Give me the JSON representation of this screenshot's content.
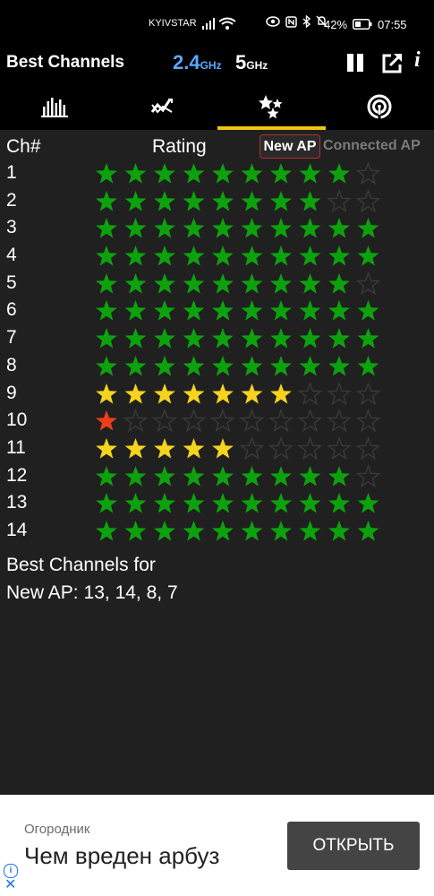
{
  "status_bar": {
    "carrier": "KYIVSTAR",
    "battery_percent": "42%",
    "time": "07:55"
  },
  "header": {
    "title": "Best Channels",
    "band_24": "2.4",
    "band_24_unit": "GHz",
    "band_5": "5",
    "band_5_unit": "GHz",
    "info_label": "i"
  },
  "tabs": {
    "icons": [
      "channel-graph-icon",
      "time-graph-icon",
      "channel-rating-icon",
      "ap-list-icon"
    ],
    "active_index": 2
  },
  "rating": {
    "ch_header": "Ch#",
    "rating_header": "Rating",
    "mode_new": "New AP",
    "mode_connected": "Connected AP",
    "max_stars": 10,
    "colors": {
      "green": "#0da20d",
      "yellow": "#f5d31e",
      "red": "#ee3d1a",
      "empty": "#3a3a3a"
    },
    "rows": [
      {
        "ch": "1",
        "stars": 9,
        "color": "green"
      },
      {
        "ch": "2",
        "stars": 8,
        "color": "green"
      },
      {
        "ch": "3",
        "stars": 10,
        "color": "green"
      },
      {
        "ch": "4",
        "stars": 10,
        "color": "green"
      },
      {
        "ch": "5",
        "stars": 9,
        "color": "green"
      },
      {
        "ch": "6",
        "stars": 10,
        "color": "green"
      },
      {
        "ch": "7",
        "stars": 10,
        "color": "green"
      },
      {
        "ch": "8",
        "stars": 10,
        "color": "green"
      },
      {
        "ch": "9",
        "stars": 7,
        "color": "yellow"
      },
      {
        "ch": "10",
        "stars": 1,
        "color": "red"
      },
      {
        "ch": "11",
        "stars": 5,
        "color": "yellow"
      },
      {
        "ch": "12",
        "stars": 9,
        "color": "green"
      },
      {
        "ch": "13",
        "stars": 10,
        "color": "green"
      },
      {
        "ch": "14",
        "stars": 10,
        "color": "green"
      }
    ],
    "summary_line1": "Best Channels for",
    "summary_label": "New AP:",
    "summary_value": "13, 14, 8, 7"
  },
  "ad": {
    "advertiser": "Огородник",
    "headline": "Чем вреден арбуз",
    "cta": "ОТКРЫТЬ"
  }
}
